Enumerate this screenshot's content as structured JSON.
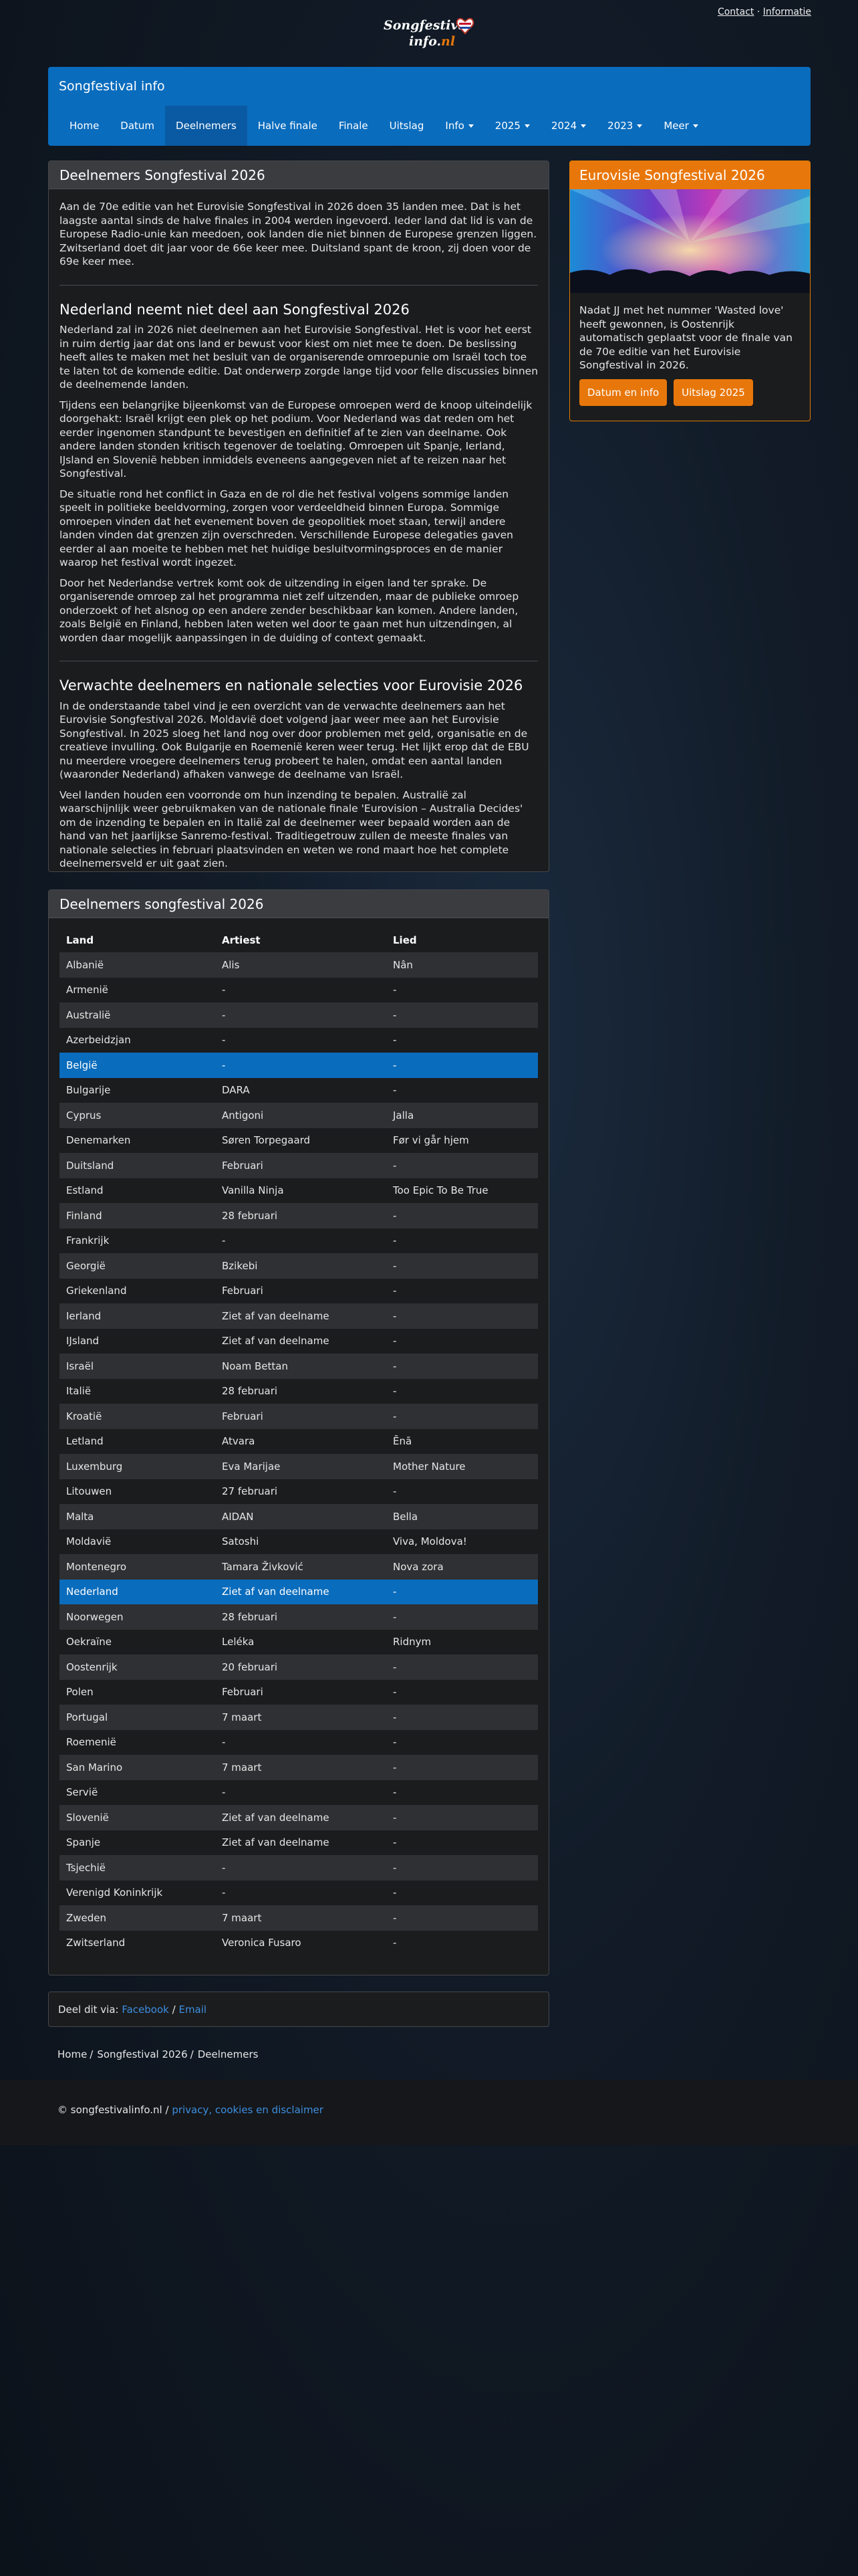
{
  "toplinks": {
    "contact": "Contact",
    "separator": " · ",
    "informatie": "Informatie"
  },
  "logo": {
    "line1": "Songfestival",
    "line2": "info.",
    "suffix": "nl"
  },
  "header": {
    "brand": "Songfestival info",
    "nav": [
      {
        "label": "Home"
      },
      {
        "label": "Datum"
      },
      {
        "label": "Deelnemers",
        "active": true
      },
      {
        "label": "Halve finale"
      },
      {
        "label": "Finale"
      },
      {
        "label": "Uitslag"
      },
      {
        "label": "Info",
        "dropdown": true
      },
      {
        "label": "2025",
        "dropdown": true
      },
      {
        "label": "2024",
        "dropdown": true
      },
      {
        "label": "2023",
        "dropdown": true
      },
      {
        "label": "Meer",
        "dropdown": true
      }
    ]
  },
  "article": {
    "title": "Deelnemers Songfestival 2026",
    "intro": "Aan de 70e editie van het Eurovisie Songfestival in 2026 doen 35 landen mee. Dat is het laagste aantal sinds de halve finales in 2004 werden ingevoerd. Ieder land dat lid is van de Europese Radio-unie kan meedoen, ook landen die niet binnen de Europese grenzen liggen. Zwitserland doet dit jaar voor de 66e keer mee. Duitsland spant de kroon, zij doen voor de 69e keer mee.",
    "section1_title": "Nederland neemt niet deel aan Songfestival 2026",
    "section1_p1": "Nederland zal in 2026 niet deelnemen aan het Eurovisie Songfestival. Het is voor het eerst in ruim dertig jaar dat ons land er bewust voor kiest om niet mee te doen. De beslissing heeft alles te maken met het besluit van de organiserende omroepunie om Israël toch toe te laten tot de komende editie. Dat onderwerp zorgde lange tijd voor felle discussies binnen de deelnemende landen.",
    "section1_p2": "Tijdens een belangrijke bijeenkomst van de Europese omroepen werd de knoop uiteindelijk doorgehakt: Israël krijgt een plek op het podium. Voor Nederland was dat reden om het eerder ingenomen standpunt te bevestigen en definitief af te zien van deelname. Ook andere landen stonden kritisch tegenover de toelating. Omroepen uit Spanje, Ierland, IJsland en Slovenië hebben inmiddels eveneens aangegeven niet af te reizen naar het Songfestival.",
    "section1_p3": "De situatie rond het conflict in Gaza en de rol die het festival volgens sommige landen speelt in politieke beeldvorming, zorgen voor verdeeldheid binnen Europa. Sommige omroepen vinden dat het evenement boven de geopolitiek moet staan, terwijl andere landen vinden dat grenzen zijn overschreden. Verschillende Europese delegaties gaven eerder al aan moeite te hebben met het huidige besluitvormingsproces en de manier waarop het festival wordt ingezet.",
    "section1_p4": "Door het Nederlandse vertrek komt ook de uitzending in eigen land ter sprake. De organiserende omroep zal het programma niet zelf uitzenden, maar de publieke omroep onderzoekt of het alsnog op een andere zender beschikbaar kan komen. Andere landen, zoals België en Finland, hebben laten weten wel door te gaan met hun uitzendingen, al worden daar mogelijk aanpassingen in de duiding of context gemaakt.",
    "section2_title": "Verwachte deelnemers en nationale selecties voor Eurovisie 2026",
    "section2_p1": "In de onderstaande tabel vind je een overzicht van de verwachte deelnemers aan het Eurovisie Songfestival 2026. Moldavië doet volgend jaar weer mee aan het Eurovisie Songfestival. In 2025 sloeg het land nog over door problemen met geld, organisatie en de creatieve invulling. Ook Bulgarije en Roemenië keren weer terug. Het lijkt erop dat de EBU nu meerdere vroegere deelnemers terug probeert te halen, omdat een aantal landen (waaronder Nederland) afhaken vanwege de deelname van Israël.",
    "section2_p2": "Veel landen houden een voorronde om hun inzending te bepalen. Australië zal waarschijnlijk weer gebruikmaken van de nationale finale 'Eurovision – Australia Decides' om de inzending te bepalen en in Italië zal de deelnemer weer bepaald worden aan de hand van het jaarlijkse Sanremo-festival. Traditiegetrouw zullen de meeste finales van nationale selecties in februari plaatsvinden en weten we rond maart hoe het complete deelnemersveld er uit gaat zien."
  },
  "sidebar": {
    "title": "Eurovisie Songfestival 2026",
    "text": "Nadat JJ met het nummer 'Wasted love' heeft gewonnen, is Oostenrijk automatisch geplaatst voor de finale van de 70e editie van het Eurovisie Songfestival in 2026.",
    "btn1": "Datum en info",
    "btn2": "Uitslag 2025"
  },
  "table": {
    "title": "Deelnemers songfestival 2026",
    "headers": [
      "Land",
      "Artiest",
      "Lied"
    ],
    "rows": [
      {
        "land": "Albanië",
        "artiest": "Alis",
        "lied": "Nân"
      },
      {
        "land": "Armenië",
        "artiest": "-",
        "lied": "-"
      },
      {
        "land": "Australië",
        "artiest": "-",
        "lied": "-"
      },
      {
        "land": "Azerbeidzjan",
        "artiest": "-",
        "lied": "-"
      },
      {
        "land": "België",
        "artiest": "-",
        "lied": "-",
        "highlight": true
      },
      {
        "land": "Bulgarije",
        "artiest": "DARA",
        "lied": "-"
      },
      {
        "land": "Cyprus",
        "artiest": "Antigoni",
        "lied": "Jalla"
      },
      {
        "land": "Denemarken",
        "artiest": "Søren Torpegaard",
        "lied": "Før vi går hjem"
      },
      {
        "land": "Duitsland",
        "artiest": "Februari",
        "lied": "-"
      },
      {
        "land": "Estland",
        "artiest": "Vanilla Ninja",
        "lied": "Too Epic To Be True"
      },
      {
        "land": "Finland",
        "artiest": "28 februari",
        "lied": "-"
      },
      {
        "land": "Frankrijk",
        "artiest": "-",
        "lied": "-"
      },
      {
        "land": "Georgië",
        "artiest": "Bzikebi",
        "lied": "-"
      },
      {
        "land": "Griekenland",
        "artiest": "Februari",
        "lied": "-"
      },
      {
        "land": "Ierland",
        "artiest": "Ziet af van deelname",
        "lied": "-"
      },
      {
        "land": "IJsland",
        "artiest": "Ziet af van deelname",
        "lied": "-"
      },
      {
        "land": "Israël",
        "artiest": "Noam Bettan",
        "lied": "-"
      },
      {
        "land": "Italië",
        "artiest": "28 februari",
        "lied": "-"
      },
      {
        "land": "Kroatië",
        "artiest": "Februari",
        "lied": "-"
      },
      {
        "land": "Letland",
        "artiest": "Atvara",
        "lied": "Ēnā"
      },
      {
        "land": "Luxemburg",
        "artiest": "Eva Marijae",
        "lied": "Mother Nature"
      },
      {
        "land": "Litouwen",
        "artiest": "27 februari",
        "lied": "-"
      },
      {
        "land": "Malta",
        "artiest": "AIDAN",
        "lied": "Bella"
      },
      {
        "land": "Moldavië",
        "artiest": "Satoshi",
        "lied": "Viva, Moldova!"
      },
      {
        "land": "Montenegro",
        "artiest": "Tamara Živković",
        "lied": "Nova zora"
      },
      {
        "land": "Nederland",
        "artiest": "Ziet af van deelname",
        "lied": "-",
        "highlight": true
      },
      {
        "land": "Noorwegen",
        "artiest": "28 februari",
        "lied": "-"
      },
      {
        "land": "Oekraïne",
        "artiest": "Leléka",
        "lied": "Ridnym"
      },
      {
        "land": "Oostenrijk",
        "artiest": "20 februari",
        "lied": "-"
      },
      {
        "land": "Polen",
        "artiest": "Februari",
        "lied": "-"
      },
      {
        "land": "Portugal",
        "artiest": "7 maart",
        "lied": "-"
      },
      {
        "land": "Roemenië",
        "artiest": "-",
        "lied": "-"
      },
      {
        "land": "San Marino",
        "artiest": "7 maart",
        "lied": "-"
      },
      {
        "land": "Servië",
        "artiest": "-",
        "lied": "-"
      },
      {
        "land": "Slovenië",
        "artiest": "Ziet af van deelname",
        "lied": "-"
      },
      {
        "land": "Spanje",
        "artiest": "Ziet af van deelname",
        "lied": "-"
      },
      {
        "land": "Tsjechië",
        "artiest": "-",
        "lied": "-"
      },
      {
        "land": "Verenigd Koninkrijk",
        "artiest": "-",
        "lied": "-"
      },
      {
        "land": "Zweden",
        "artiest": "7 maart",
        "lied": "-"
      },
      {
        "land": "Zwitserland",
        "artiest": "Veronica Fusaro",
        "lied": "-"
      }
    ]
  },
  "share": {
    "label": "Deel dit via:",
    "facebook": "Facebook",
    "separator": "/",
    "email": "Email"
  },
  "breadcrumb": [
    "Home",
    "Songfestival 2026",
    "Deelnemers"
  ],
  "footer": {
    "copyright": "© songfestivalinfo.nl /",
    "link": "privacy, cookies en disclaimer"
  },
  "colors": {
    "brand_blue": "#0a6cbd",
    "accent_orange": "#e8770b",
    "panel_bg": "#1b1c1e"
  }
}
